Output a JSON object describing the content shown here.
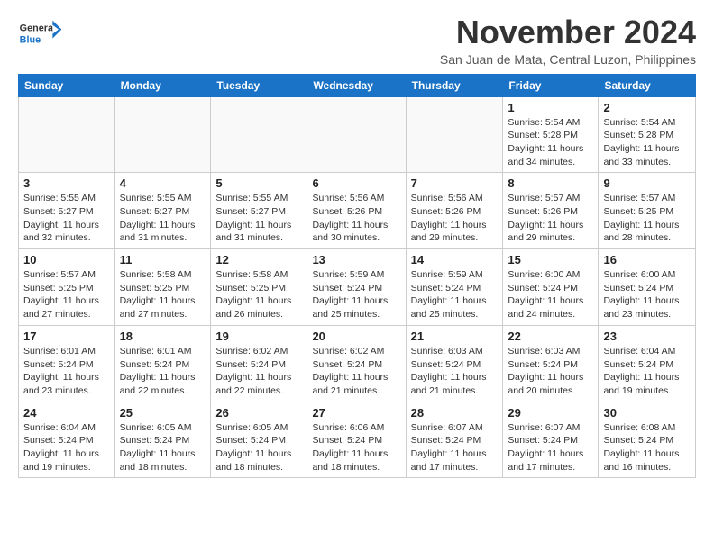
{
  "header": {
    "logo_general": "General",
    "logo_blue": "Blue",
    "month": "November 2024",
    "location": "San Juan de Mata, Central Luzon, Philippines"
  },
  "weekdays": [
    "Sunday",
    "Monday",
    "Tuesday",
    "Wednesday",
    "Thursday",
    "Friday",
    "Saturday"
  ],
  "weeks": [
    [
      {
        "day": "",
        "info": ""
      },
      {
        "day": "",
        "info": ""
      },
      {
        "day": "",
        "info": ""
      },
      {
        "day": "",
        "info": ""
      },
      {
        "day": "",
        "info": ""
      },
      {
        "day": "1",
        "info": "Sunrise: 5:54 AM\nSunset: 5:28 PM\nDaylight: 11 hours\nand 34 minutes."
      },
      {
        "day": "2",
        "info": "Sunrise: 5:54 AM\nSunset: 5:28 PM\nDaylight: 11 hours\nand 33 minutes."
      }
    ],
    [
      {
        "day": "3",
        "info": "Sunrise: 5:55 AM\nSunset: 5:27 PM\nDaylight: 11 hours\nand 32 minutes."
      },
      {
        "day": "4",
        "info": "Sunrise: 5:55 AM\nSunset: 5:27 PM\nDaylight: 11 hours\nand 31 minutes."
      },
      {
        "day": "5",
        "info": "Sunrise: 5:55 AM\nSunset: 5:27 PM\nDaylight: 11 hours\nand 31 minutes."
      },
      {
        "day": "6",
        "info": "Sunrise: 5:56 AM\nSunset: 5:26 PM\nDaylight: 11 hours\nand 30 minutes."
      },
      {
        "day": "7",
        "info": "Sunrise: 5:56 AM\nSunset: 5:26 PM\nDaylight: 11 hours\nand 29 minutes."
      },
      {
        "day": "8",
        "info": "Sunrise: 5:57 AM\nSunset: 5:26 PM\nDaylight: 11 hours\nand 29 minutes."
      },
      {
        "day": "9",
        "info": "Sunrise: 5:57 AM\nSunset: 5:25 PM\nDaylight: 11 hours\nand 28 minutes."
      }
    ],
    [
      {
        "day": "10",
        "info": "Sunrise: 5:57 AM\nSunset: 5:25 PM\nDaylight: 11 hours\nand 27 minutes."
      },
      {
        "day": "11",
        "info": "Sunrise: 5:58 AM\nSunset: 5:25 PM\nDaylight: 11 hours\nand 27 minutes."
      },
      {
        "day": "12",
        "info": "Sunrise: 5:58 AM\nSunset: 5:25 PM\nDaylight: 11 hours\nand 26 minutes."
      },
      {
        "day": "13",
        "info": "Sunrise: 5:59 AM\nSunset: 5:24 PM\nDaylight: 11 hours\nand 25 minutes."
      },
      {
        "day": "14",
        "info": "Sunrise: 5:59 AM\nSunset: 5:24 PM\nDaylight: 11 hours\nand 25 minutes."
      },
      {
        "day": "15",
        "info": "Sunrise: 6:00 AM\nSunset: 5:24 PM\nDaylight: 11 hours\nand 24 minutes."
      },
      {
        "day": "16",
        "info": "Sunrise: 6:00 AM\nSunset: 5:24 PM\nDaylight: 11 hours\nand 23 minutes."
      }
    ],
    [
      {
        "day": "17",
        "info": "Sunrise: 6:01 AM\nSunset: 5:24 PM\nDaylight: 11 hours\nand 23 minutes."
      },
      {
        "day": "18",
        "info": "Sunrise: 6:01 AM\nSunset: 5:24 PM\nDaylight: 11 hours\nand 22 minutes."
      },
      {
        "day": "19",
        "info": "Sunrise: 6:02 AM\nSunset: 5:24 PM\nDaylight: 11 hours\nand 22 minutes."
      },
      {
        "day": "20",
        "info": "Sunrise: 6:02 AM\nSunset: 5:24 PM\nDaylight: 11 hours\nand 21 minutes."
      },
      {
        "day": "21",
        "info": "Sunrise: 6:03 AM\nSunset: 5:24 PM\nDaylight: 11 hours\nand 21 minutes."
      },
      {
        "day": "22",
        "info": "Sunrise: 6:03 AM\nSunset: 5:24 PM\nDaylight: 11 hours\nand 20 minutes."
      },
      {
        "day": "23",
        "info": "Sunrise: 6:04 AM\nSunset: 5:24 PM\nDaylight: 11 hours\nand 19 minutes."
      }
    ],
    [
      {
        "day": "24",
        "info": "Sunrise: 6:04 AM\nSunset: 5:24 PM\nDaylight: 11 hours\nand 19 minutes."
      },
      {
        "day": "25",
        "info": "Sunrise: 6:05 AM\nSunset: 5:24 PM\nDaylight: 11 hours\nand 18 minutes."
      },
      {
        "day": "26",
        "info": "Sunrise: 6:05 AM\nSunset: 5:24 PM\nDaylight: 11 hours\nand 18 minutes."
      },
      {
        "day": "27",
        "info": "Sunrise: 6:06 AM\nSunset: 5:24 PM\nDaylight: 11 hours\nand 18 minutes."
      },
      {
        "day": "28",
        "info": "Sunrise: 6:07 AM\nSunset: 5:24 PM\nDaylight: 11 hours\nand 17 minutes."
      },
      {
        "day": "29",
        "info": "Sunrise: 6:07 AM\nSunset: 5:24 PM\nDaylight: 11 hours\nand 17 minutes."
      },
      {
        "day": "30",
        "info": "Sunrise: 6:08 AM\nSunset: 5:24 PM\nDaylight: 11 hours\nand 16 minutes."
      }
    ]
  ]
}
